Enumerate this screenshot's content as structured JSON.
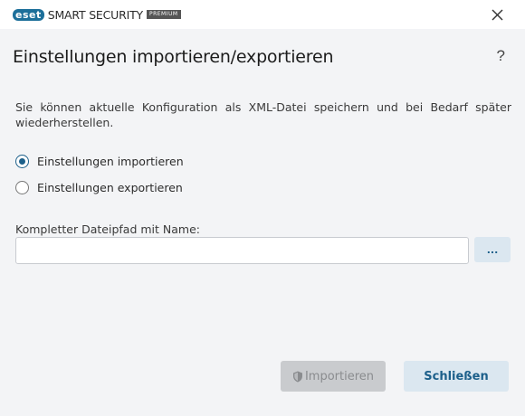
{
  "titlebar": {
    "logo_brand": "eset",
    "logo_product": "SMART SECURITY",
    "logo_tier": "PREMIUM",
    "close_icon": "close-icon"
  },
  "dialog": {
    "title": "Einstellungen importieren/exportieren",
    "help_label": "?",
    "description": "Sie können aktuelle Konfiguration als XML-Datei speichern und bei Bedarf später wiederherstellen.",
    "options": [
      {
        "label": "Einstellungen importieren",
        "selected": true
      },
      {
        "label": "Einstellungen exportieren",
        "selected": false
      }
    ],
    "path_label": "Kompletter Dateipfad mit Name:",
    "path_value": "",
    "browse_label": "...",
    "import_button": "Importieren",
    "import_button_enabled": false,
    "close_button": "Schließen"
  },
  "colors": {
    "accent": "#1c5f8a",
    "brand": "#1d6f9a",
    "background": "#f3f4f6"
  }
}
